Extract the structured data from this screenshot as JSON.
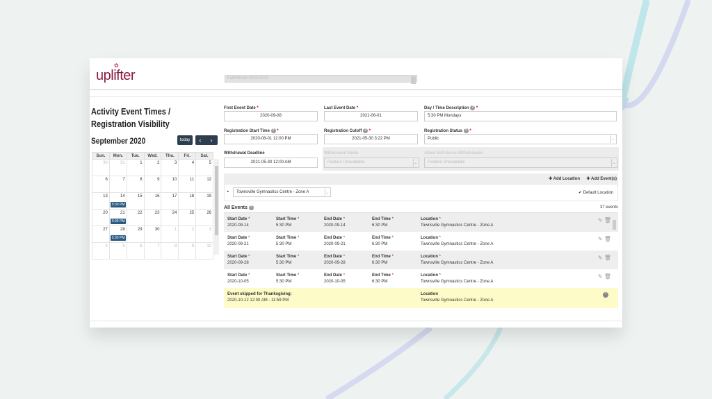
{
  "header": {
    "logo": "uplifter",
    "season": "Fall/Winter 2020-2021"
  },
  "left": {
    "title": "Activity Event Times / Registration Visibility",
    "month": "September 2020",
    "today": "today",
    "prev": "‹",
    "next": "›",
    "weekdays": [
      "Sun.",
      "Mon.",
      "Tue.",
      "Wed.",
      "Thu.",
      "Fri.",
      "Sat."
    ],
    "weeks": [
      [
        [
          "30",
          1
        ],
        [
          "31",
          1
        ],
        [
          "1"
        ],
        [
          "2"
        ],
        [
          "3"
        ],
        [
          "4"
        ],
        [
          "5"
        ]
      ],
      [
        [
          "6"
        ],
        [
          "7"
        ],
        [
          "8"
        ],
        [
          "9"
        ],
        [
          "10"
        ],
        [
          "11"
        ],
        [
          "12"
        ]
      ],
      [
        [
          "13"
        ],
        [
          "14",
          0,
          "5:30 PM"
        ],
        [
          "15"
        ],
        [
          "16"
        ],
        [
          "17"
        ],
        [
          "18"
        ],
        [
          "19"
        ]
      ],
      [
        [
          "20"
        ],
        [
          "21",
          0,
          "5:30 PM"
        ],
        [
          "22"
        ],
        [
          "23"
        ],
        [
          "24"
        ],
        [
          "25"
        ],
        [
          "26"
        ]
      ],
      [
        [
          "27"
        ],
        [
          "28",
          0,
          "5:30 PM"
        ],
        [
          "29"
        ],
        [
          "30"
        ],
        [
          "1",
          1
        ],
        [
          "2",
          1
        ],
        [
          "3",
          1
        ]
      ],
      [
        [
          "4",
          1
        ],
        [
          "5",
          1
        ],
        [
          "6",
          1
        ],
        [
          "7",
          1
        ],
        [
          "8",
          1
        ],
        [
          "9",
          1
        ],
        [
          "10",
          1
        ]
      ]
    ]
  },
  "form": {
    "first_event_label": "First Event Date",
    "first_event": "2020-09-08",
    "last_event_label": "Last Event Date",
    "last_event": "2021-06-01",
    "daytime_label": "Day / Time Description",
    "daytime": "5:30 PM Mondays",
    "reg_start_label": "Registration Start Time",
    "reg_start": "2020-08-01 12:00 PM",
    "reg_cutoff_label": "Registration Cutoff",
    "reg_cutoff": "2021-05-30 3:22 PM",
    "reg_status_label": "Registration Status",
    "reg_status": "Public",
    "withdraw_label": "Withdrawal Deadline",
    "withdraw": "2021-05-30 12:00 AM",
    "withdraw_mode_label": "Withdrawal Mode",
    "withdraw_mode": "Feature Unavailable",
    "self_serve_label": "Allow Self-Serve Withdrawals",
    "self_serve": "Feature Unavailable"
  },
  "locations": {
    "add_location": "Add Location",
    "add_events": "Add Event(s)",
    "selected": "Townsville Gymnastics Centre - Zone A",
    "default": "Default Location"
  },
  "events": {
    "title": "All Events",
    "count": "37 events",
    "headers": {
      "start_date": "Start Date",
      "start_time": "Start Time",
      "end_date": "End Date",
      "end_time": "End Time",
      "location": "Location"
    },
    "rows": [
      {
        "start_date": "2020-09-14",
        "start_time": "5:30 PM",
        "end_date": "2020-09-14",
        "end_time": "6:30 PM",
        "location": "Townsville Gymnastics Centre - Zone A"
      },
      {
        "start_date": "2020-09-21",
        "start_time": "5:30 PM",
        "end_date": "2020-09-21",
        "end_time": "6:30 PM",
        "location": "Townsville Gymnastics Centre - Zone A"
      },
      {
        "start_date": "2020-09-28",
        "start_time": "5:30 PM",
        "end_date": "2020-09-28",
        "end_time": "6:30 PM",
        "location": "Townsville Gymnastics Centre - Zone A"
      },
      {
        "start_date": "2020-10-05",
        "start_time": "5:30 PM",
        "end_date": "2020-10-05",
        "end_time": "6:30 PM",
        "location": "Townsville Gymnastics Centre - Zone A"
      }
    ],
    "skipped": {
      "title": "Event skipped for Thanksgiving:",
      "range": "2020-10-12 12:00 AM - 11:59 PM",
      "location_label": "Location",
      "location": "Townsville Gymnastics Centre - Zone A"
    }
  },
  "colors": {
    "accent": "#2d3e50",
    "event_chip": "#2a5b84",
    "logo": "#8a1c3e",
    "skipped_bg": "#fdfbc8"
  }
}
